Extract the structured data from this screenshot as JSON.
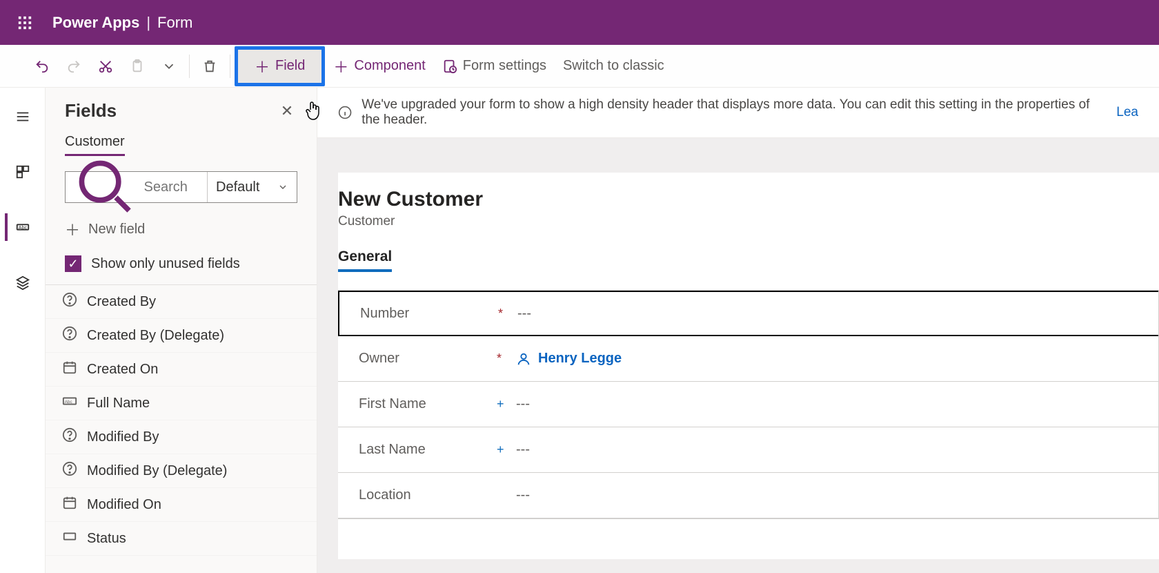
{
  "header": {
    "app": "Power Apps",
    "divider": "|",
    "page": "Form"
  },
  "toolbar": {
    "field": "Field",
    "component": "Component",
    "form_settings": "Form settings",
    "switch_classic": "Switch to classic"
  },
  "infobar": {
    "text": "We've upgraded your form to show a high density header that displays more data. You can edit this setting in the properties of the header.",
    "link": "Lea"
  },
  "fields_pane": {
    "title": "Fields",
    "tab": "Customer",
    "search_placeholder": "Search",
    "filter": "Default",
    "new_field": "New field",
    "show_unused": "Show only unused fields",
    "items": [
      {
        "icon": "q",
        "label": "Created By"
      },
      {
        "icon": "q",
        "label": "Created By (Delegate)"
      },
      {
        "icon": "cal",
        "label": "Created On"
      },
      {
        "icon": "abc",
        "label": "Full Name"
      },
      {
        "icon": "q",
        "label": "Modified By"
      },
      {
        "icon": "q",
        "label": "Modified By (Delegate)"
      },
      {
        "icon": "cal",
        "label": "Modified On"
      },
      {
        "icon": "box",
        "label": "Status"
      }
    ]
  },
  "form": {
    "title": "New Customer",
    "subtitle": "Customer",
    "tab": "General",
    "rows": [
      {
        "label": "Number",
        "req": "*",
        "reqclass": "red",
        "value": "---",
        "selected": true
      },
      {
        "label": "Owner",
        "req": "*",
        "reqclass": "red",
        "value": "Henry Legge",
        "person": true
      },
      {
        "label": "First Name",
        "req": "+",
        "reqclass": "blue",
        "value": "---"
      },
      {
        "label": "Last Name",
        "req": "+",
        "reqclass": "blue",
        "value": "---"
      },
      {
        "label": "Location",
        "req": "",
        "reqclass": "",
        "value": "---"
      }
    ]
  }
}
